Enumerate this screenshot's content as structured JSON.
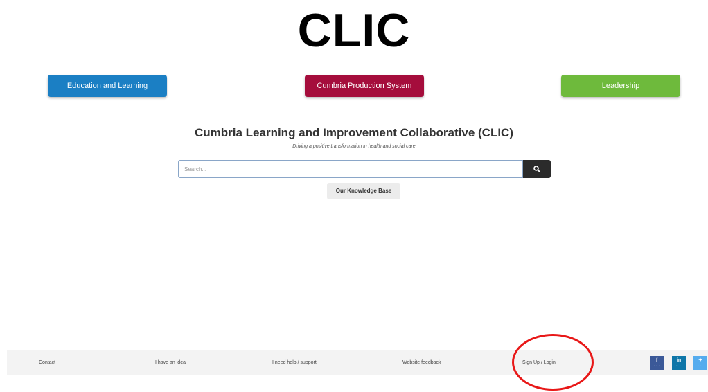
{
  "logo": {
    "text": "CLIC"
  },
  "nav": [
    {
      "label": "Education and Learning",
      "color": "#1b7fc4"
    },
    {
      "label": "Cumbria Production System",
      "color": "#a50d3c"
    },
    {
      "label": "Leadership",
      "color": "#6eba3c"
    }
  ],
  "hero": {
    "title": "Cumbria Learning and Improvement Collaborative (CLIC)",
    "tagline": "Driving a positive transformation in health and social care"
  },
  "search": {
    "placeholder": "Search...",
    "button_icon": "search-icon"
  },
  "knowledge_base": {
    "label": "Our Knowledge Base"
  },
  "footer": {
    "links": [
      {
        "label": "Contact"
      },
      {
        "label": "I have an idea"
      },
      {
        "label": "I need help / support"
      },
      {
        "label": "Website feedback"
      },
      {
        "label": "Sign Up / Login"
      }
    ],
    "social": [
      {
        "glyph": "f",
        "sub": "facebook",
        "icon": "facebook-icon",
        "color": "#3b5998"
      },
      {
        "glyph": "in",
        "sub": "linkedin",
        "icon": "linkedin-icon",
        "color": "#0e76a8"
      },
      {
        "glyph": "✦",
        "sub": "twitter",
        "icon": "twitter-icon",
        "color": "#55acee"
      }
    ]
  },
  "annotation": {
    "color": "#e81818"
  }
}
